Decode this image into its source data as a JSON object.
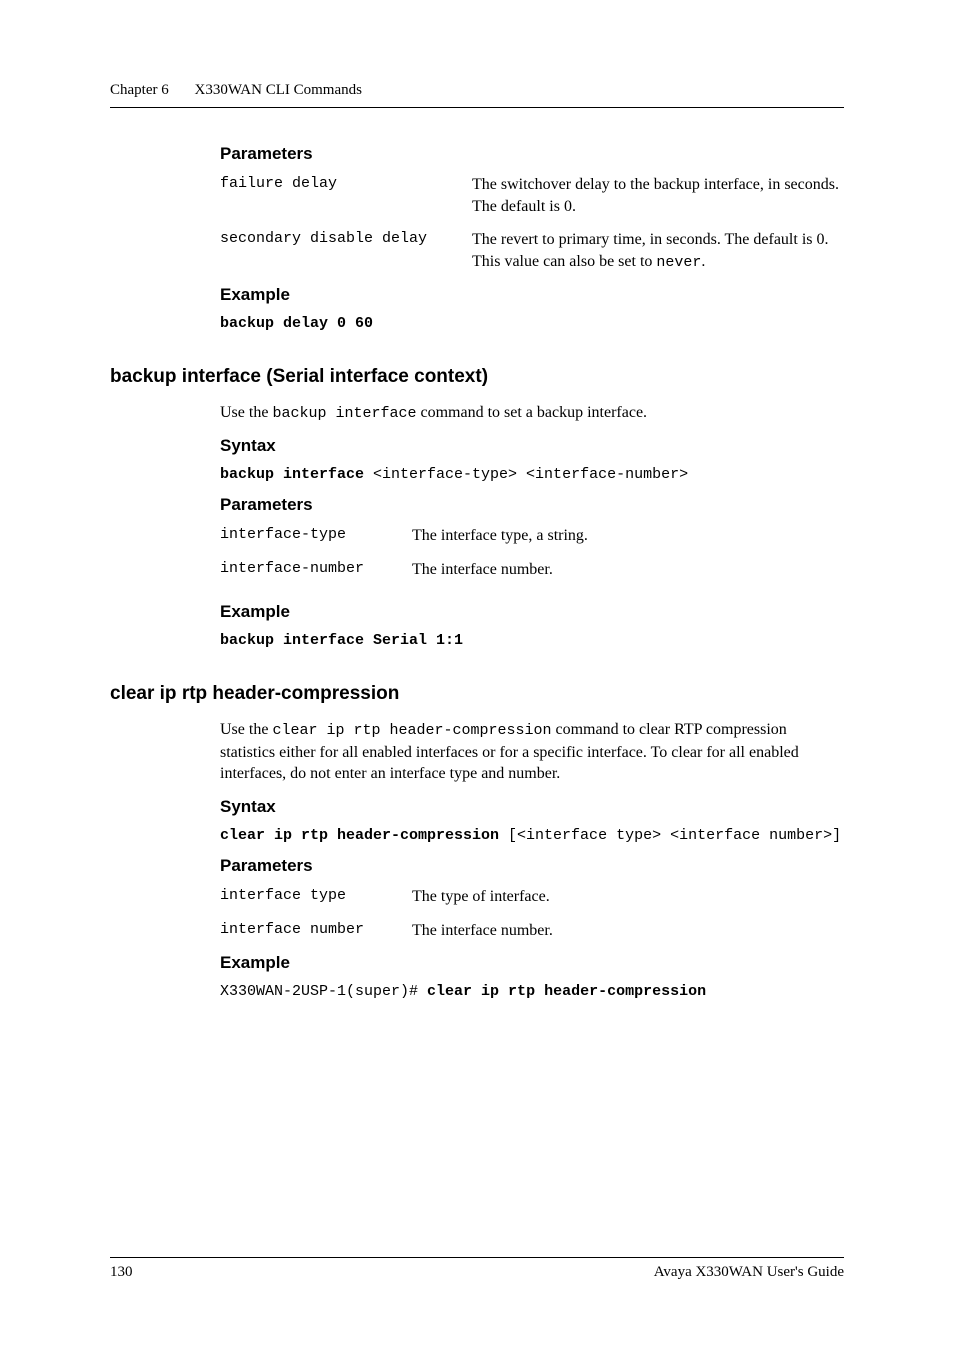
{
  "header": {
    "chapter": "Chapter 6",
    "title": "X330WAN CLI Commands"
  },
  "section1": {
    "heading": "Parameters",
    "params": [
      {
        "name": "failure delay",
        "desc_pre": "The switchover delay to the backup interface, in seconds. The default is 0."
      },
      {
        "name": "secondary disable delay",
        "desc_pre": "The revert to primary time, in seconds. The default is 0. This value can also be set to ",
        "code": "never",
        "desc_post": "."
      }
    ],
    "example_heading": "Example",
    "example_code": "backup delay 0 60"
  },
  "section2": {
    "h2": "backup interface (Serial interface context)",
    "intro_pre": "Use the ",
    "intro_code": "backup interface",
    "intro_post": " command to set a backup interface.",
    "syntax_heading": "Syntax",
    "syntax_bold": "backup interface",
    "syntax_rest": " <interface-type> <interface-number>",
    "params_heading": "Parameters",
    "params": [
      {
        "name": "interface-type",
        "desc": "The interface type, a string."
      },
      {
        "name": "interface-number",
        "desc": "The interface number."
      }
    ],
    "example_heading": "Example",
    "example_code": "backup interface Serial 1:1"
  },
  "section3": {
    "h2": "clear ip rtp header-compression",
    "intro_pre": "Use the ",
    "intro_code": "clear ip rtp header-compression",
    "intro_post": " command to clear RTP compression statistics either for all enabled interfaces or for a specific interface. To clear for all enabled interfaces, do not enter an interface type and number.",
    "syntax_heading": "Syntax",
    "syntax_bold": "clear ip rtp header-compression",
    "syntax_rest": " [<interface type> <interface number>]",
    "params_heading": "Parameters",
    "params": [
      {
        "name": "interface type",
        "desc": "The type of interface."
      },
      {
        "name": "interface number",
        "desc": "The interface number."
      }
    ],
    "example_heading": "Example",
    "example_prompt": "X330WAN-2USP-1(super)# ",
    "example_cmd": "clear ip rtp header-compression"
  },
  "footer": {
    "page": "130",
    "title": "Avaya X330WAN User's Guide"
  }
}
